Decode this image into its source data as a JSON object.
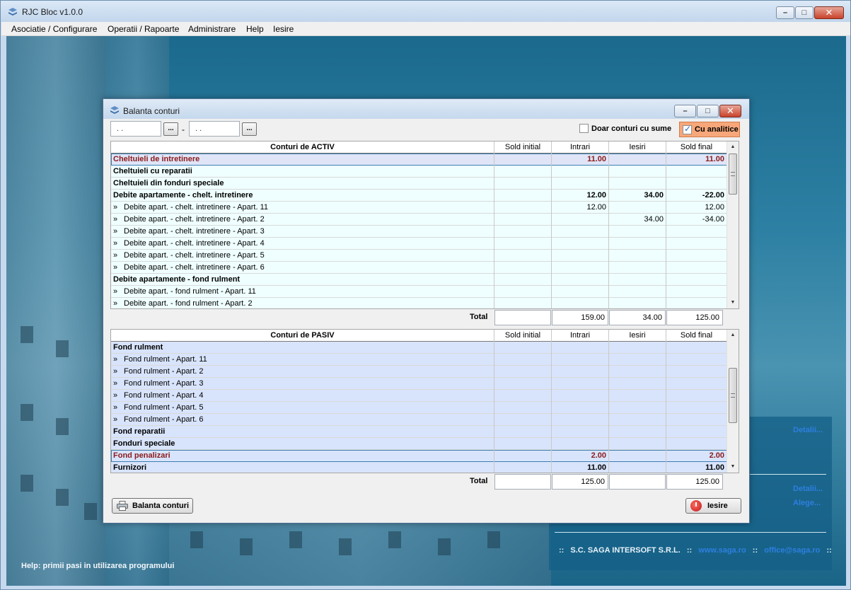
{
  "app": {
    "title": "RJC Bloc v1.0.0"
  },
  "menu": [
    "Asociatie / Configurare",
    "Operatii / Rapoarte",
    "Administrare",
    "Help",
    "Iesire"
  ],
  "dialog": {
    "title": "Balanta conturi",
    "date_from": ". .",
    "date_to": ". .",
    "dots_label": "...",
    "date_separator": "-",
    "doar_conturi_label": "Doar conturi cu sume",
    "cu_analitice_label": "Cu analitice",
    "cu_analitice_checked": true,
    "print_button": "Balanta conturi",
    "exit_button": "Iesire"
  },
  "activ": {
    "columns": [
      "Conturi de ACTIV",
      "Sold initial",
      "Intrari",
      "Iesiri",
      "Sold final"
    ],
    "rows": [
      {
        "name": "Cheltuieli de intretinere",
        "sold_initial": "",
        "intrari": "11.00",
        "iesiri": "",
        "sold_final": "11.00",
        "kind": "selected"
      },
      {
        "name": "Cheltuieli cu reparatii",
        "sold_initial": "",
        "intrari": "",
        "iesiri": "",
        "sold_final": "",
        "kind": "bold"
      },
      {
        "name": "Cheltuieli din fonduri speciale",
        "sold_initial": "",
        "intrari": "",
        "iesiri": "",
        "sold_final": "",
        "kind": "bold"
      },
      {
        "name": "Debite apartamente - chelt. intretinere",
        "sold_initial": "",
        "intrari": "12.00",
        "iesiri": "34.00",
        "sold_final": "-22.00",
        "kind": "bold"
      },
      {
        "name": "Debite apart. - chelt. intretinere - Apart. 11",
        "sold_initial": "",
        "intrari": "12.00",
        "iesiri": "",
        "sold_final": "12.00",
        "kind": "child"
      },
      {
        "name": "Debite apart. - chelt. intretinere - Apart. 2",
        "sold_initial": "",
        "intrari": "",
        "iesiri": "34.00",
        "sold_final": "-34.00",
        "kind": "child"
      },
      {
        "name": "Debite apart. - chelt. intretinere - Apart. 3",
        "sold_initial": "",
        "intrari": "",
        "iesiri": "",
        "sold_final": "",
        "kind": "child"
      },
      {
        "name": "Debite apart. - chelt. intretinere - Apart. 4",
        "sold_initial": "",
        "intrari": "",
        "iesiri": "",
        "sold_final": "",
        "kind": "child"
      },
      {
        "name": "Debite apart. - chelt. intretinere - Apart. 5",
        "sold_initial": "",
        "intrari": "",
        "iesiri": "",
        "sold_final": "",
        "kind": "child"
      },
      {
        "name": "Debite apart. - chelt. intretinere - Apart. 6",
        "sold_initial": "",
        "intrari": "",
        "iesiri": "",
        "sold_final": "",
        "kind": "child"
      },
      {
        "name": "Debite apartamente - fond rulment",
        "sold_initial": "",
        "intrari": "",
        "iesiri": "",
        "sold_final": "",
        "kind": "bold"
      },
      {
        "name": "Debite apart. - fond rulment - Apart. 11",
        "sold_initial": "",
        "intrari": "",
        "iesiri": "",
        "sold_final": "",
        "kind": "child"
      },
      {
        "name": "Debite apart. - fond rulment - Apart. 2",
        "sold_initial": "",
        "intrari": "",
        "iesiri": "",
        "sold_final": "",
        "kind": "child"
      }
    ],
    "total_label": "Total",
    "totals": [
      "",
      "159.00",
      "34.00",
      "125.00"
    ]
  },
  "pasiv": {
    "columns": [
      "Conturi de PASIV",
      "Sold initial",
      "Intrari",
      "Iesiri",
      "Sold final"
    ],
    "rows": [
      {
        "name": "Fond rulment",
        "sold_initial": "",
        "intrari": "",
        "iesiri": "",
        "sold_final": "",
        "kind": "bold"
      },
      {
        "name": "Fond rulment - Apart. 11",
        "sold_initial": "",
        "intrari": "",
        "iesiri": "",
        "sold_final": "",
        "kind": "child"
      },
      {
        "name": "Fond rulment - Apart. 2",
        "sold_initial": "",
        "intrari": "",
        "iesiri": "",
        "sold_final": "",
        "kind": "child"
      },
      {
        "name": "Fond rulment - Apart. 3",
        "sold_initial": "",
        "intrari": "",
        "iesiri": "",
        "sold_final": "",
        "kind": "child"
      },
      {
        "name": "Fond rulment - Apart. 4",
        "sold_initial": "",
        "intrari": "",
        "iesiri": "",
        "sold_final": "",
        "kind": "child"
      },
      {
        "name": "Fond rulment - Apart. 5",
        "sold_initial": "",
        "intrari": "",
        "iesiri": "",
        "sold_final": "",
        "kind": "child"
      },
      {
        "name": "Fond rulment - Apart. 6",
        "sold_initial": "",
        "intrari": "",
        "iesiri": "",
        "sold_final": "",
        "kind": "child"
      },
      {
        "name": "Fond reparatii",
        "sold_initial": "",
        "intrari": "",
        "iesiri": "",
        "sold_final": "",
        "kind": "bold"
      },
      {
        "name": "Fonduri speciale",
        "sold_initial": "",
        "intrari": "",
        "iesiri": "",
        "sold_final": "",
        "kind": "bold"
      },
      {
        "name": "Fond penalizari",
        "sold_initial": "",
        "intrari": "2.00",
        "iesiri": "",
        "sold_final": "2.00",
        "kind": "selected"
      },
      {
        "name": "Furnizori",
        "sold_initial": "",
        "intrari": "11.00",
        "iesiri": "",
        "sold_final": "11.00",
        "kind": "bold"
      }
    ],
    "total_label": "Total",
    "totals": [
      "",
      "125.00",
      "",
      "125.00"
    ]
  },
  "child_marker": "»",
  "info_panel": {
    "links": [
      "Detalii...",
      "Detalii...",
      "Alege..."
    ],
    "company": "S.C. SAGA INTERSOFT S.R.L.",
    "website": "www.saga.ro",
    "email": "office@saga.ro",
    "separator": "::"
  },
  "help_text": "Help: primii pasi in utilizarea programului",
  "colors": {
    "activ_row_bg": "#effefe",
    "pasiv_row_bg": "#d8e4fb",
    "selected_row_bg_activ": "#dfe5f7",
    "selected_text": "#8b1a1a",
    "accent_check": "#f7a77a"
  }
}
